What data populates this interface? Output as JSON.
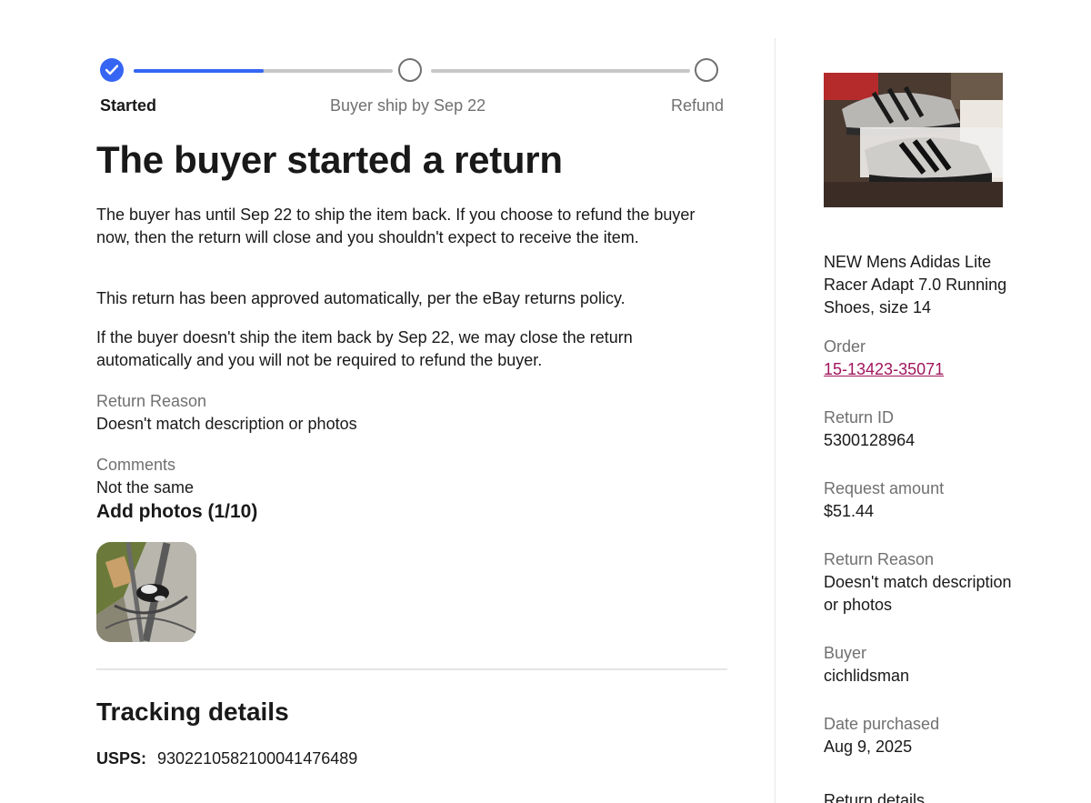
{
  "stepper": {
    "steps": [
      {
        "label": "Started",
        "state": "complete"
      },
      {
        "label": "Buyer ship by Sep 22",
        "state": "pending"
      },
      {
        "label": "Refund",
        "state": "pending"
      }
    ],
    "progress_to_next": 0.5,
    "accent_color": "#3665f3"
  },
  "main": {
    "title": "The buyer started a return",
    "paragraph_1": "The buyer has until Sep 22 to ship the item back. If you choose to refund the buyer now, then the return will close and you shouldn't expect to receive the item.",
    "paragraph_2": "This return has been approved automatically, per the eBay returns policy.",
    "paragraph_3": "If the buyer doesn't ship the item back by Sep 22, we may close the return automatically and you will not be required to refund the buyer.",
    "return_reason_label": "Return Reason",
    "return_reason_value": "Doesn't match description or photos",
    "comments_label": "Comments",
    "comments_value": "Not the same",
    "add_photos_label": "Add photos (1/10)",
    "tracking_title": "Tracking details",
    "tracking_carrier": "USPS:",
    "tracking_number": "9302210582100041476489"
  },
  "sidebar": {
    "item_title": "NEW Mens Adidas Lite Racer Adapt 7.0 Running Shoes, size 14",
    "order_label": "Order",
    "order_value": "15-13423-35071",
    "return_id_label": "Return ID",
    "return_id_value": "5300128964",
    "request_amount_label": "Request amount",
    "request_amount_value": "$51.44",
    "return_reason_label": "Return Reason",
    "return_reason_value": "Doesn't match description or photos",
    "buyer_label": "Buyer",
    "buyer_value": "cichlidsman",
    "date_purchased_label": "Date purchased",
    "date_purchased_value": "Aug 9, 2025",
    "return_details_label": "Return details",
    "link_color": "#a0165d"
  }
}
